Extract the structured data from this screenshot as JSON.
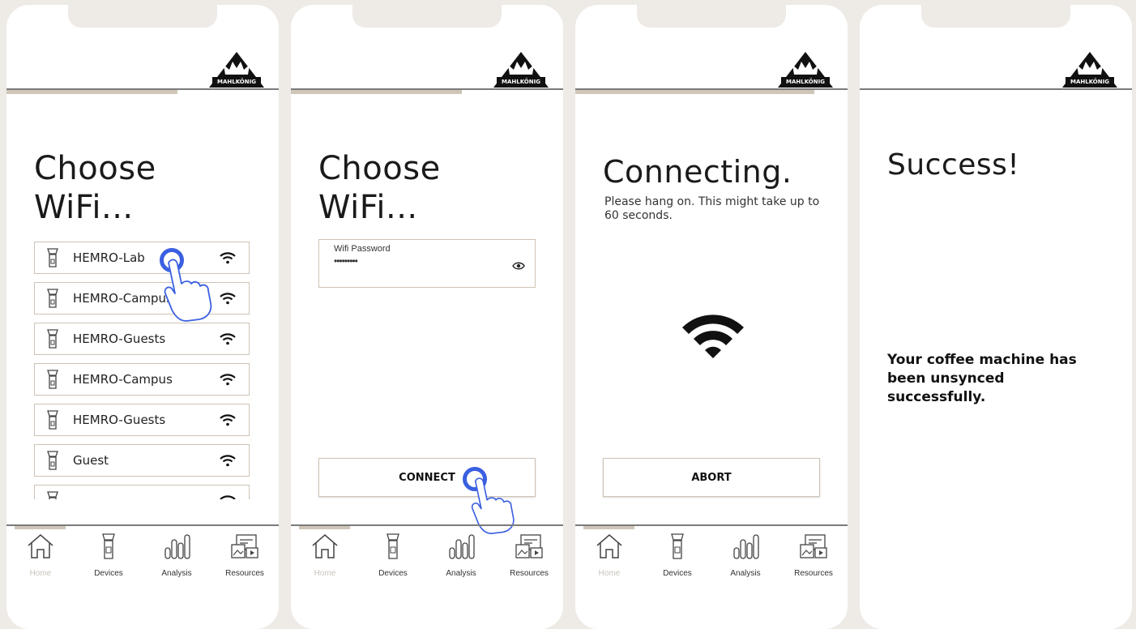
{
  "brand": "MAHLKÖNIG",
  "colors": {
    "background": "#eeeae6",
    "accent": "#3a5fe0",
    "border": "#cfc3b5",
    "tab_accent": "#cfc6b8"
  },
  "nav": {
    "home": "Home",
    "devices": "Devices",
    "analysis": "Analysis",
    "resources": "Resources",
    "icons": [
      "home-icon",
      "grinder-icon",
      "bar-chart-icon",
      "resources-icon"
    ]
  },
  "screen1": {
    "title_line1": "Choose",
    "title_line2": "WiFi...",
    "networks": [
      {
        "name": "HEMRO-Lab"
      },
      {
        "name": "HEMRO-Campus"
      },
      {
        "name": "HEMRO-Guests"
      },
      {
        "name": "HEMRO-Campus"
      },
      {
        "name": "HEMRO-Guests"
      },
      {
        "name": "Guest"
      },
      {
        "name": ""
      }
    ]
  },
  "screen2": {
    "title_line1": "Choose",
    "title_line2": "WiFi...",
    "password_label": "Wifi Password",
    "password_value": "•••••••••",
    "connect_label": "CONNECT"
  },
  "screen3": {
    "title": "Connecting.",
    "subtitle": "Please hang on. This might take up to 60 seconds.",
    "abort_label": "ABORT"
  },
  "screen4": {
    "title": "Success!",
    "message": "Your coffee machine has been unsynced successfully."
  }
}
